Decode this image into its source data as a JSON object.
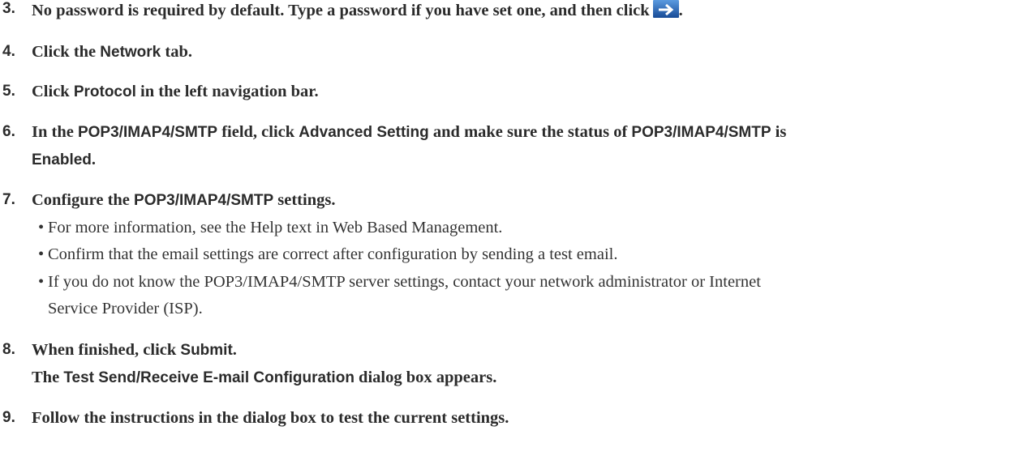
{
  "steps": {
    "s3": {
      "num": "3.",
      "text": "No password is required by default. Type a password if you have set one, and then click",
      "after_icon": ".",
      "icon": "arrow-right-icon"
    },
    "s4": {
      "num": "4.",
      "a": "Click the ",
      "kw1": "Network",
      "b": " tab."
    },
    "s5": {
      "num": "5.",
      "a": "Click ",
      "kw1": "Protocol",
      "b": " in the left navigation bar."
    },
    "s6": {
      "num": "6.",
      "a": "In the ",
      "kw1": "POP3/IMAP4/SMTP",
      "b": " field, click ",
      "kw2": "Advanced Setting",
      "c": " and make sure the status of ",
      "kw3": "POP3/IMAP4/SMTP",
      "d": " is",
      "kw4": "Enabled",
      "e": "."
    },
    "s7": {
      "num": "7.",
      "a": "Configure the ",
      "kw1": "POP3/IMAP4/SMTP",
      "b": " settings.",
      "bullets": [
        "For more information, see the Help text in Web Based Management.",
        "Confirm that the email settings are correct after configuration by sending a test email.",
        "If you do not know the POP3/IMAP4/SMTP server settings, contact your network administrator or Internet",
        "Service Provider (ISP)."
      ]
    },
    "s8": {
      "num": "8.",
      "a": "When finished, click ",
      "kw1": "Submit",
      "b": ".",
      "c": "The ",
      "kw2": "Test Send/Receive E-mail Configuration",
      "d": " dialog box appears."
    },
    "s9": {
      "num": "9.",
      "text": "Follow the instructions in the dialog box to test the current settings."
    }
  },
  "colors": {
    "text": "#2b2b2b",
    "icon_bg_top": "#4f8fd6",
    "icon_bg_bottom": "#1b4f9c"
  }
}
